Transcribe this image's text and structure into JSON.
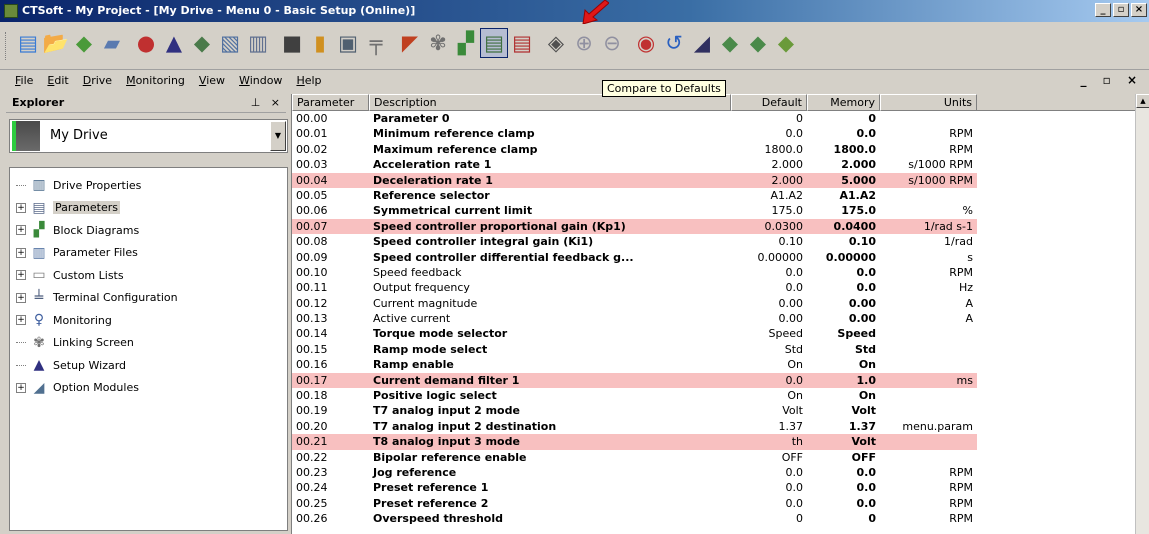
{
  "window": {
    "title": "CTSoft - My Project - [My Drive - Menu 0 - Basic Setup  (Online)]",
    "min": "_",
    "max": "▫",
    "close": "×"
  },
  "toolbar": {
    "icons": [
      {
        "name": "new-project-icon",
        "glyph": "▤",
        "color": "#3a7bd5"
      },
      {
        "name": "open-project-icon",
        "glyph": "📂",
        "color": "#c8a040"
      },
      {
        "name": "add-drive-icon",
        "glyph": "◆",
        "color": "#4a9a3a"
      },
      {
        "name": "open-folder-icon",
        "glyph": "▰",
        "color": "#5a7ab0"
      },
      {
        "name": "sep"
      },
      {
        "name": "online-icon",
        "glyph": "●",
        "color": "#c03030"
      },
      {
        "name": "setup-wizard-icon",
        "glyph": "▲",
        "color": "#303080"
      },
      {
        "name": "drive-properties-icon",
        "glyph": "◆",
        "color": "#4a7a4a"
      },
      {
        "name": "block-diagram-icon",
        "glyph": "▧",
        "color": "#5070a0"
      },
      {
        "name": "parameter-file-icon",
        "glyph": "▥",
        "color": "#607090"
      },
      {
        "name": "sep"
      },
      {
        "name": "store-icon",
        "glyph": "■",
        "color": "#404040"
      },
      {
        "name": "traffic-light-icon",
        "glyph": "▮",
        "color": "#d09020"
      },
      {
        "name": "monitor-icon",
        "glyph": "▣",
        "color": "#506070"
      },
      {
        "name": "terminal-icon",
        "glyph": "╤",
        "color": "#707070"
      },
      {
        "name": "sep"
      },
      {
        "name": "scope-icon",
        "glyph": "◤",
        "color": "#c04020"
      },
      {
        "name": "linking-icon",
        "glyph": "✾",
        "color": "#707070"
      },
      {
        "name": "block-diagrams-icon",
        "glyph": "▞",
        "color": "#3a8a3a"
      },
      {
        "name": "compare-to-defaults-icon",
        "glyph": "▤",
        "color": "#407040",
        "active": true
      },
      {
        "name": "compare-files-icon",
        "glyph": "▤",
        "color": "#b03030"
      },
      {
        "name": "sep"
      },
      {
        "name": "print-icon",
        "glyph": "◈",
        "color": "#505050"
      },
      {
        "name": "zoom-in-icon",
        "glyph": "⊕",
        "color": "#9090a0"
      },
      {
        "name": "zoom-out-icon",
        "glyph": "⊖",
        "color": "#9090a0"
      },
      {
        "name": "sep"
      },
      {
        "name": "stop-icon",
        "glyph": "◉",
        "color": "#c03030"
      },
      {
        "name": "refresh-icon",
        "glyph": "↺",
        "color": "#2a60c0"
      },
      {
        "name": "tool-icon",
        "glyph": "◢",
        "color": "#303060"
      },
      {
        "name": "drive-upload-icon",
        "glyph": "◆",
        "color": "#4a8a4a"
      },
      {
        "name": "drive-download-icon",
        "glyph": "◆",
        "color": "#4a8a4a"
      },
      {
        "name": "drive-compare-icon",
        "glyph": "◆",
        "color": "#6a9a3a"
      }
    ],
    "tooltip": "Compare to Defaults"
  },
  "menu": [
    {
      "ul": "F",
      "rest": "ile"
    },
    {
      "ul": "E",
      "rest": "dit"
    },
    {
      "ul": "D",
      "rest": "rive"
    },
    {
      "ul": "M",
      "rest": "onitoring"
    },
    {
      "ul": "V",
      "rest": "iew"
    },
    {
      "ul": "W",
      "rest": "indow"
    },
    {
      "ul": "H",
      "rest": "elp"
    }
  ],
  "explorer": {
    "title": "Explorer",
    "pin": "⊥",
    "close": "×",
    "drive": "My Drive",
    "tree": [
      {
        "label": "Drive Properties",
        "expandable": false,
        "icon": "drive-properties-icon",
        "glyph": "▥",
        "color": "#4a6a8a"
      },
      {
        "label": "Parameters",
        "expandable": true,
        "icon": "parameters-icon",
        "glyph": "▤",
        "color": "#5a6a8a",
        "selected": true
      },
      {
        "label": "Block Diagrams",
        "expandable": true,
        "icon": "block-diagrams-icon",
        "glyph": "▞",
        "color": "#3a8a3a"
      },
      {
        "label": "Parameter Files",
        "expandable": true,
        "icon": "parameter-files-icon",
        "glyph": "▥",
        "color": "#5070a0"
      },
      {
        "label": "Custom Lists",
        "expandable": true,
        "icon": "custom-lists-icon",
        "glyph": "▭",
        "color": "#808080"
      },
      {
        "label": "Terminal Configuration",
        "expandable": true,
        "icon": "terminal-configuration-icon",
        "glyph": "╧",
        "color": "#506080"
      },
      {
        "label": "Monitoring",
        "expandable": true,
        "icon": "monitoring-icon",
        "glyph": "♀",
        "color": "#4060a0"
      },
      {
        "label": "Linking Screen",
        "expandable": false,
        "icon": "linking-screen-icon",
        "glyph": "✾",
        "color": "#707070"
      },
      {
        "label": "Setup Wizard",
        "expandable": false,
        "icon": "setup-wizard-icon",
        "glyph": "▲",
        "color": "#303080"
      },
      {
        "label": "Option Modules",
        "expandable": true,
        "icon": "option-modules-icon",
        "glyph": "◢",
        "color": "#507090"
      }
    ]
  },
  "table": {
    "headers": {
      "param": "Parameter",
      "desc": "Description",
      "def": "Default",
      "mem": "Memory",
      "units": "Units"
    },
    "rows": [
      {
        "p": "00.00",
        "d": "Parameter 0",
        "db": true,
        "def": "0",
        "mem": "0",
        "u": "",
        "hl": false
      },
      {
        "p": "00.01",
        "d": "Minimum reference clamp",
        "db": true,
        "def": "0.0",
        "mem": "0.0",
        "u": "RPM",
        "hl": false
      },
      {
        "p": "00.02",
        "d": "Maximum reference clamp",
        "db": true,
        "def": "1800.0",
        "mem": "1800.0",
        "u": "RPM",
        "hl": false
      },
      {
        "p": "00.03",
        "d": "Acceleration rate 1",
        "db": true,
        "def": "2.000",
        "mem": "2.000",
        "u": "s/1000 RPM",
        "hl": false
      },
      {
        "p": "00.04",
        "d": "Deceleration rate 1",
        "db": true,
        "def": "2.000",
        "mem": "5.000",
        "u": "s/1000 RPM",
        "hl": true
      },
      {
        "p": "00.05",
        "d": "Reference selector",
        "db": true,
        "def": "A1.A2",
        "mem": "A1.A2",
        "u": "",
        "hl": false
      },
      {
        "p": "00.06",
        "d": "Symmetrical current limit",
        "db": true,
        "def": "175.0",
        "mem": "175.0",
        "u": "%",
        "hl": false
      },
      {
        "p": "00.07",
        "d": "Speed controller proportional gain (Kp1)",
        "db": true,
        "def": "0.0300",
        "mem": "0.0400",
        "u": "1/rad s-1",
        "hl": true
      },
      {
        "p": "00.08",
        "d": "Speed controller integral gain (Ki1)",
        "db": true,
        "def": "0.10",
        "mem": "0.10",
        "u": "1/rad",
        "hl": false
      },
      {
        "p": "00.09",
        "d": "Speed controller differential feedback g...",
        "db": true,
        "def": "0.00000",
        "mem": "0.00000",
        "u": "s",
        "hl": false
      },
      {
        "p": "00.10",
        "d": "Speed feedback",
        "db": false,
        "def": "0.0",
        "mem": "0.0",
        "u": "RPM",
        "hl": false
      },
      {
        "p": "00.11",
        "d": "Output frequency",
        "db": false,
        "def": "0.0",
        "mem": "0.0",
        "u": "Hz",
        "hl": false
      },
      {
        "p": "00.12",
        "d": "Current magnitude",
        "db": false,
        "def": "0.00",
        "mem": "0.00",
        "u": "A",
        "hl": false
      },
      {
        "p": "00.13",
        "d": "Active current",
        "db": false,
        "def": "0.00",
        "mem": "0.00",
        "u": "A",
        "hl": false
      },
      {
        "p": "00.14",
        "d": "Torque mode selector",
        "db": true,
        "def": "Speed",
        "mem": "Speed",
        "u": "",
        "hl": false
      },
      {
        "p": "00.15",
        "d": "Ramp mode select",
        "db": true,
        "def": "Std",
        "mem": "Std",
        "u": "",
        "hl": false
      },
      {
        "p": "00.16",
        "d": "Ramp enable",
        "db": true,
        "def": "On",
        "mem": "On",
        "u": "",
        "hl": false
      },
      {
        "p": "00.17",
        "d": "Current demand filter 1",
        "db": true,
        "def": "0.0",
        "mem": "1.0",
        "u": "ms",
        "hl": true
      },
      {
        "p": "00.18",
        "d": "Positive logic select",
        "db": true,
        "def": "On",
        "mem": "On",
        "u": "",
        "hl": false
      },
      {
        "p": "00.19",
        "d": "T7 analog input 2 mode",
        "db": true,
        "def": "Volt",
        "mem": "Volt",
        "u": "",
        "hl": false
      },
      {
        "p": "00.20",
        "d": "T7 analog input 2 destination",
        "db": true,
        "def": "1.37",
        "mem": "1.37",
        "u": "menu.param",
        "hl": false
      },
      {
        "p": "00.21",
        "d": "T8 analog input 3 mode",
        "db": true,
        "def": "th",
        "mem": "Volt",
        "u": "",
        "hl": true
      },
      {
        "p": "00.22",
        "d": "Bipolar reference enable",
        "db": true,
        "def": "OFF",
        "mem": "OFF",
        "u": "",
        "hl": false
      },
      {
        "p": "00.23",
        "d": "Jog reference",
        "db": true,
        "def": "0.0",
        "mem": "0.0",
        "u": "RPM",
        "hl": false
      },
      {
        "p": "00.24",
        "d": "Preset reference 1",
        "db": true,
        "def": "0.0",
        "mem": "0.0",
        "u": "RPM",
        "hl": false
      },
      {
        "p": "00.25",
        "d": "Preset reference 2",
        "db": true,
        "def": "0.0",
        "mem": "0.0",
        "u": "RPM",
        "hl": false
      },
      {
        "p": "00.26",
        "d": "Overspeed threshold",
        "db": true,
        "def": "0",
        "mem": "0",
        "u": "RPM",
        "hl": false
      }
    ]
  }
}
